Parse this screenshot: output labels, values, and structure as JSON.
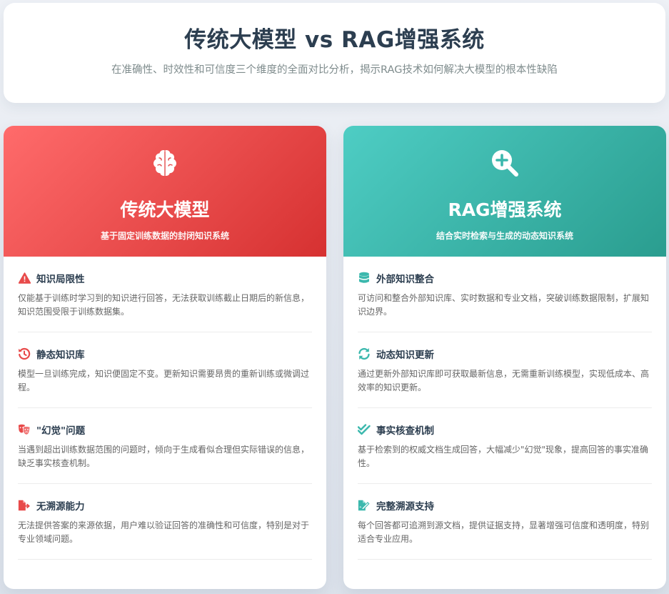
{
  "header": {
    "title": "传统大模型 vs RAG增强系统",
    "subtitle": "在准确性、时效性和可信度三个维度的全面对比分析，揭示RAG技术如何解决大模型的根本性缺陷"
  },
  "colors": {
    "traditional_accent": "#e84a4a",
    "rag_accent": "#3bb8ad"
  },
  "traditional": {
    "icon": "brain-icon",
    "title": "传统大模型",
    "subtitle": "基于固定训练数据的封闭知识系统",
    "items": [
      {
        "icon": "warning-triangle-icon",
        "title": "知识局限性",
        "desc": "仅能基于训练时学习到的知识进行回答，无法获取训练截止日期后的新信息，知识范围受限于训练数据集。"
      },
      {
        "icon": "history-icon",
        "title": "静态知识库",
        "desc": "模型一旦训练完成，知识便固定不变。更新知识需要昂贵的重新训练或微调过程。"
      },
      {
        "icon": "theater-masks-icon",
        "title": "\"幻觉\"问题",
        "desc": "当遇到超出训练数据范围的问题时，倾向于生成看似合理但实际错误的信息，缺乏事实核查机制。"
      },
      {
        "icon": "file-export-icon",
        "title": "无溯源能力",
        "desc": "无法提供答案的来源依据，用户难以验证回答的准确性和可信度，特别是对于专业领域问题。"
      }
    ]
  },
  "rag": {
    "icon": "search-plus-icon",
    "title": "RAG增强系统",
    "subtitle": "结合实时检索与生成的动态知识系统",
    "items": [
      {
        "icon": "database-icon",
        "title": "外部知识整合",
        "desc": "可访问和整合外部知识库、实时数据和专业文档，突破训练数据限制，扩展知识边界。"
      },
      {
        "icon": "sync-icon",
        "title": "动态知识更新",
        "desc": "通过更新外部知识库即可获取最新信息，无需重新训练模型，实现低成本、高效率的知识更新。"
      },
      {
        "icon": "double-check-icon",
        "title": "事实核查机制",
        "desc": "基于检索到的权威文档生成回答，大幅减少\"幻觉\"现象，提高回答的事实准确性。"
      },
      {
        "icon": "file-signature-icon",
        "title": "完整溯源支持",
        "desc": "每个回答都可追溯到源文档，提供证据支持，显著增强可信度和透明度，特别适合专业应用。"
      }
    ]
  }
}
